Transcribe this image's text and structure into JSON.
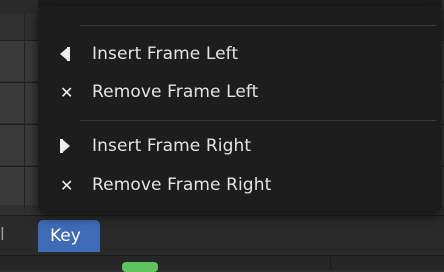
{
  "menu": {
    "items": [
      {
        "icon": "insert-frame-left-icon",
        "label": "Insert Frame Left"
      },
      {
        "icon": "remove-icon",
        "icon_glyph": "✕",
        "label": "Remove Frame Left"
      },
      {
        "icon": "insert-frame-right-icon",
        "label": "Insert Frame Right"
      },
      {
        "icon": "remove-icon",
        "icon_glyph": "✕",
        "label": "Remove Frame Right"
      }
    ]
  },
  "tabs": {
    "prev_partial": "l",
    "active": "Key"
  },
  "colors": {
    "menu_bg": "#1d1d1d",
    "active_tab": "#3f6ab5",
    "green_marker": "#5ec45e"
  }
}
